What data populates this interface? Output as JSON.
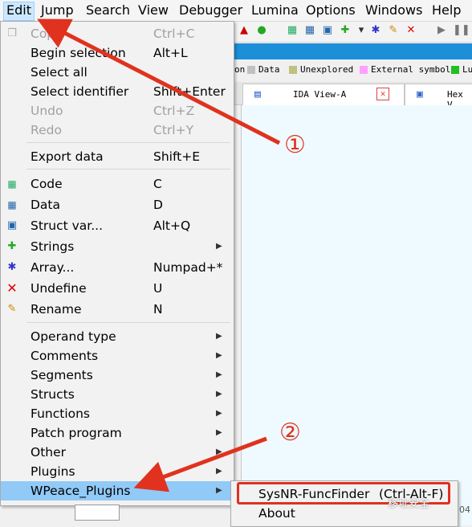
{
  "menubar": {
    "items": [
      "Edit",
      "Jump",
      "Search",
      "View",
      "Debugger",
      "Lumina",
      "Options",
      "Windows",
      "Help"
    ]
  },
  "legend": {
    "items": [
      {
        "label": "on",
        "color": null
      },
      {
        "label": "Data",
        "color": "#c0c0c0"
      },
      {
        "label": "Unexplored",
        "color": "#c0c080"
      },
      {
        "label": "External symbol",
        "color": "#ffa0ff"
      },
      {
        "label": "Lu",
        "color": "#20c020"
      }
    ]
  },
  "tabs": {
    "ida_view": "IDA View-A",
    "hex_view": "Hex V"
  },
  "edit_menu": {
    "items": [
      {
        "label": "Copy",
        "shortcut": "Ctrl+C",
        "disabled": true,
        "icon": "copy-icon"
      },
      {
        "label": "Begin selection",
        "shortcut": "Alt+L"
      },
      {
        "label": "Select all",
        "shortcut": ""
      },
      {
        "label": "Select identifier",
        "shortcut": "Shift+Enter"
      },
      {
        "label": "Undo",
        "shortcut": "Ctrl+Z",
        "disabled": true
      },
      {
        "label": "Redo",
        "shortcut": "Ctrl+Y",
        "disabled": true
      },
      {
        "label": "Export data",
        "shortcut": "Shift+E"
      },
      {
        "label": "Code",
        "shortcut": "C",
        "icon": "code-icon"
      },
      {
        "label": "Data",
        "shortcut": "D",
        "icon": "data-icon"
      },
      {
        "label": "Struct var...",
        "shortcut": "Alt+Q",
        "icon": "struct-icon"
      },
      {
        "label": "Strings",
        "shortcut": "",
        "submenu": true,
        "icon": "strings-icon"
      },
      {
        "label": "Array...",
        "shortcut": "Numpad+*",
        "icon": "array-icon"
      },
      {
        "label": "Undefine",
        "shortcut": "U",
        "icon": "undefine-icon"
      },
      {
        "label": "Rename",
        "shortcut": "N",
        "icon": "rename-icon"
      },
      {
        "label": "Operand type",
        "submenu": true
      },
      {
        "label": "Comments",
        "submenu": true
      },
      {
        "label": "Segments",
        "submenu": true
      },
      {
        "label": "Structs",
        "submenu": true
      },
      {
        "label": "Functions",
        "submenu": true
      },
      {
        "label": "Patch program",
        "submenu": true
      },
      {
        "label": "Other",
        "submenu": true
      },
      {
        "label": "Plugins",
        "submenu": true
      },
      {
        "label": "WPeace_Plugins",
        "submenu": true,
        "highlighted": true
      }
    ]
  },
  "submenu": {
    "items": [
      {
        "label": "SysNR-FuncFinder",
        "shortcut": "(Ctrl-Alt-F)"
      },
      {
        "label": "About",
        "shortcut": ""
      }
    ]
  },
  "annotations": {
    "callout_1": "①",
    "callout_2": "②",
    "color": "#e0321e"
  },
  "watermark": "移址安全",
  "corner_number": "04"
}
